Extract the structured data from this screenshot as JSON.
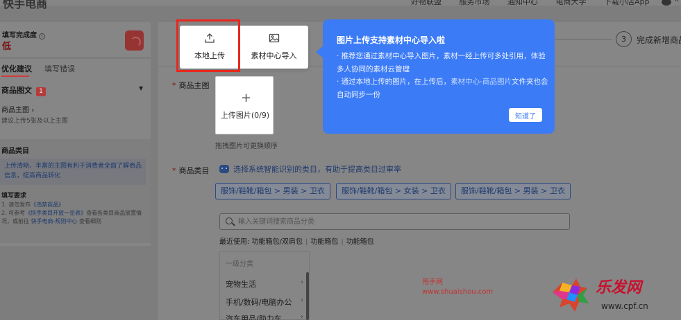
{
  "topnav": {
    "brand": "快手电商",
    "items": [
      "好物联盟",
      "服务市场",
      "通知中心",
      "电商大学",
      "下载小店App"
    ],
    "user": "k"
  },
  "sidebar": {
    "progress": {
      "title": "填写完成度",
      "level": "低"
    },
    "tabs": [
      "优化建议",
      "填写错误"
    ],
    "section": {
      "title": "商品图文",
      "count": "1"
    },
    "sub": {
      "title": "商品主图 ›",
      "desc": "建议上传5张及以上主图"
    },
    "category": {
      "title": "商品类目",
      "tip": "上传清晰、丰富的主图有利于消费者全面了解商品信息，提高商品转化"
    },
    "requirements": {
      "title": "填写要求",
      "line1_prefix": "1. 请勿发布",
      "line1_link": "《违禁商品》",
      "line2_prefix": "2. 可参考",
      "line2_link1": "《快手类目开放一览表》",
      "line2_mid": "查看各类目商品放置情况，或前往",
      "line2_link2": "快手电商-规则中心",
      "line2_suffix": "查看细则"
    }
  },
  "steps": {
    "num": "3",
    "label": "完成新增商品"
  },
  "form": {
    "image_label": "商品主图",
    "upload_text": "上传图片(0/9)",
    "drag_hint": "拖拽图片可更换顺序",
    "category_label": "商品类目",
    "ai_hint": "选择系统智能识别的类目，有助于提高类目过审率",
    "suggestions": [
      "服饰/鞋靴/箱包 > 男装 > 卫衣",
      "服饰/鞋靴/箱包 > 女装 > 卫衣",
      "服饰/鞋靴/箱包 > 男装 > 卫衣"
    ],
    "search_placeholder": "输入关键词搜索商品分类",
    "recent_label": "最近使用:",
    "recent": [
      "功能箱包/双肩包",
      "功能箱包",
      "功能箱包"
    ],
    "level1_head": "一级分类",
    "categories": [
      "宠物生活",
      "手机/数码/电脑办公",
      "汽车用品/助力车"
    ]
  },
  "popover": {
    "local_upload": "本地上传",
    "material_import": "素材中心导入"
  },
  "tooltip": {
    "title": "图片上传支持素材中心导入啦",
    "p1": "· 推荐您通过素材中心导入图片，素材一经上传可多处引用，体验多人协同的素材云管理",
    "p2_prefix": "· 通过本地上传的图片，在上传后，",
    "p2_highlight": "素材中心-商品图片",
    "p2_suffix": "文件夹也会自动同步一份",
    "button": "知道了"
  },
  "watermark": {
    "site_name": "甩手网",
    "site_url": "www.shuaishou.com"
  },
  "colors": {
    "tooltip_bg": "#3b7bf6",
    "highlight_border": "#e8271e",
    "accent_red": "#7a1010"
  }
}
